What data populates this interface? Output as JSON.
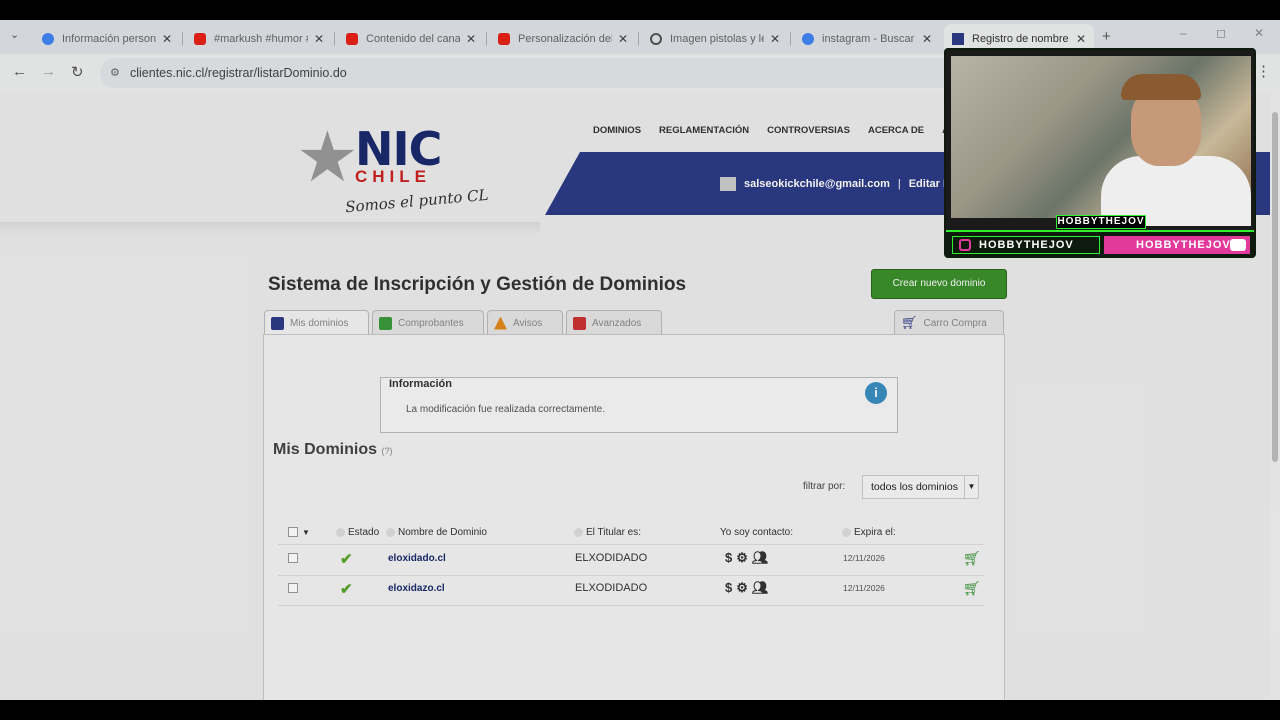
{
  "browser": {
    "tabs": [
      {
        "title": "Información personal",
        "icon": "google-icon",
        "color": "#4285f4"
      },
      {
        "title": "#markush #humor #",
        "icon": "youtube-icon",
        "color": "#e62117"
      },
      {
        "title": "Contenido del canal",
        "icon": "youtube-icon",
        "color": "#e62117"
      },
      {
        "title": "Personalización del",
        "icon": "youtube-icon",
        "color": "#e62117"
      },
      {
        "title": "Imagen pistolas y le",
        "icon": "globe-icon",
        "color": "#555555"
      },
      {
        "title": "instagram - Buscar c",
        "icon": "google-icon",
        "color": "#4285f4"
      },
      {
        "title": "Registro de nombre",
        "icon": "nic-icon",
        "color": "#2c3a86",
        "active": true
      }
    ],
    "url": "clientes.nic.cl/registrar/listarDominio.do"
  },
  "header": {
    "logo_main": "NIC",
    "logo_sub": "CHILE",
    "logo_tagline": "Somos el punto CL",
    "nav": [
      "DOMINIOS",
      "REGLAMENTACIÓN",
      "CONTROVERSIAS",
      "ACERCA DE",
      "AY"
    ],
    "user_email": "salseokickchile@gmail.com",
    "edit_label": "Editar P"
  },
  "main": {
    "title": "Sistema de Inscripción y Gestión de Dominios",
    "new_domain_button": "Crear nuevo dominio",
    "tabs": [
      "Mis dominios",
      "Comprobantes",
      "Avisos",
      "Avanzados"
    ],
    "cart_tab": "Carro Compra",
    "info_box": {
      "title": "Información",
      "message": "La modificación fue realizada correctamente."
    },
    "section_title": "Mis Dominios",
    "section_help": "(?)",
    "filter_label": "filtrar por:",
    "filter_value": "todos los dominios",
    "columns": {
      "estado": "Estado",
      "nombre": "Nombre de Dominio",
      "titular": "El Titular es:",
      "contacto": "Yo soy contacto:",
      "expira": "Expira el:"
    },
    "rows": [
      {
        "domain": "eloxidado.cl",
        "holder": "ELXODIDADO",
        "expires": "12/11/2026"
      },
      {
        "domain": "eloxidazo.cl",
        "holder": "ELXODIDADO",
        "expires": "12/11/2026"
      }
    ]
  },
  "overlay": {
    "streamer_name": "HOBBYTHEJOV",
    "instagram_handle": "HOBBYTHEJOV",
    "youtube_handle": "HOBBYTHEJOV"
  }
}
